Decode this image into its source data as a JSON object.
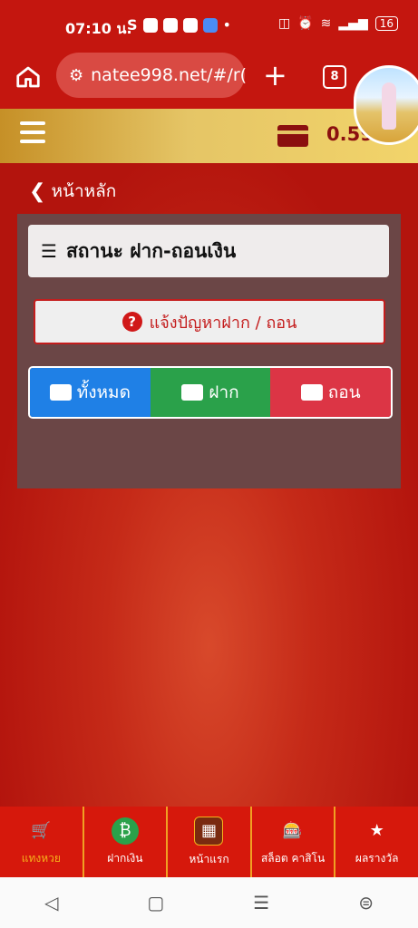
{
  "status_bar": {
    "time": "07:10 น.",
    "battery": "16"
  },
  "browser": {
    "url": "natee998.net/#/r(",
    "tab_count": "8"
  },
  "app_bar": {
    "balance": "0.59"
  },
  "page": {
    "back_label": "หน้าหลัก",
    "title": "สถานะ ฝาก-ถอนเงิน",
    "report_label": "แจ้งปัญหาฝาก / ถอน",
    "filters": [
      "ทั้งหมด",
      "ฝาก",
      "ถอน"
    ]
  },
  "bottom_nav": [
    {
      "label": "แทงหวย",
      "icon": "cart-icon"
    },
    {
      "label": "ฝากเงิน",
      "icon": "bitcoin-icon"
    },
    {
      "label": "หน้าแรก",
      "icon": "home-icon"
    },
    {
      "label": "สล็อต คาสิโน",
      "icon": "slot-icon"
    },
    {
      "label": "ผลรางวัล",
      "icon": "jackpot-icon"
    }
  ],
  "colors": {
    "primary": "#c4160f",
    "gold": "#e5c566",
    "all": "#1f80e6",
    "deposit": "#2aa14a",
    "withdraw": "#dc3545"
  }
}
